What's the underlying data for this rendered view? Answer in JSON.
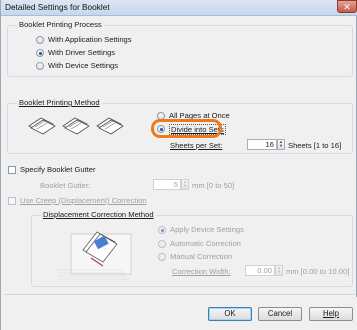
{
  "window": {
    "title": "Detailed Settings for Booklet",
    "close_glyph": "✕"
  },
  "booklet_process": {
    "label": "Booklet Printing Process",
    "options": [
      {
        "label": "With Application Settings",
        "selected": false
      },
      {
        "label": "With Driver Settings",
        "selected": true
      },
      {
        "label": "With Device Settings",
        "selected": false
      }
    ]
  },
  "booklet_method": {
    "label": "Booklet Printing Method",
    "options": [
      {
        "label": "All Pages at Once",
        "selected": false
      },
      {
        "label": "Divide into Sets",
        "selected": true
      }
    ],
    "sheets_label": "Sheets per Set:",
    "sheets_value": "16",
    "sheets_range": "Sheets [1 to 16]"
  },
  "gutter": {
    "checkbox_label": "Specify Booklet Gutter",
    "checked": false,
    "field_label": "Booklet Gutter:",
    "value": "5",
    "range": "mm [0 to 50]"
  },
  "creep": {
    "checkbox_label": "Use Creep (Displacement) Correction",
    "checked": false,
    "group_label": "Displacement Correction Method",
    "options": [
      {
        "label": "Apply Device Settings",
        "selected": true
      },
      {
        "label": "Automatic Correction",
        "selected": false
      },
      {
        "label": "Manual Correction",
        "selected": false
      }
    ],
    "width_label": "Correction Width:",
    "width_value": "0.00",
    "width_range": "mm [0.00 to 10.00]"
  },
  "footer": {
    "ok": "OK",
    "cancel": "Cancel",
    "help": "Help"
  }
}
